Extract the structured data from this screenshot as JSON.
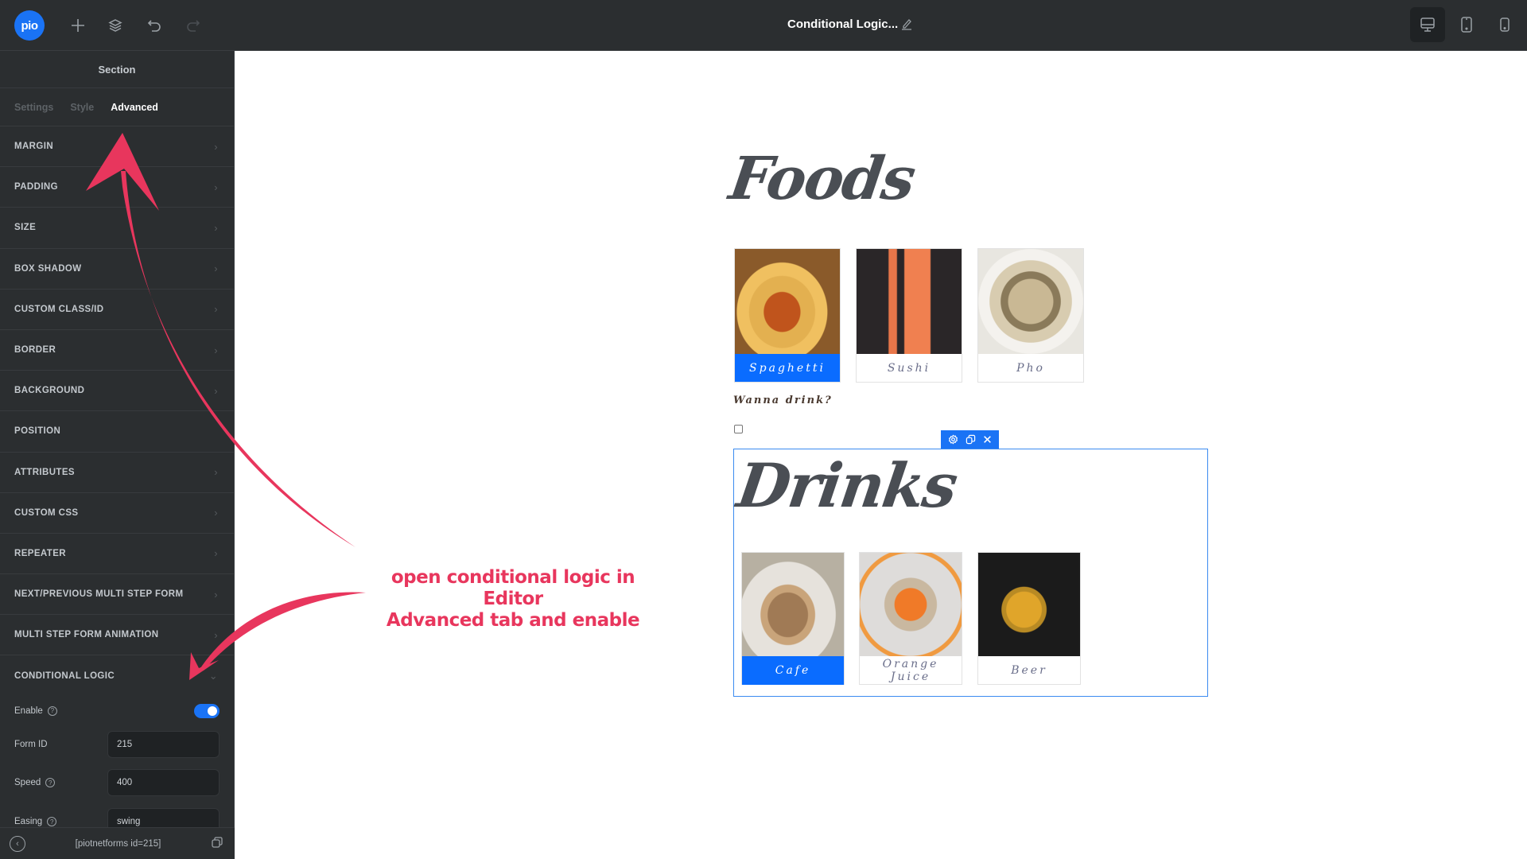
{
  "topbar": {
    "logo_text": "pio",
    "doc_title": "Conditional Logic...",
    "icons": [
      "plus-icon",
      "layers-icon",
      "undo-icon",
      "redo-icon",
      "edit-pencil-icon"
    ],
    "devices": [
      {
        "name": "desktop",
        "active": true
      },
      {
        "name": "tablet",
        "active": false
      },
      {
        "name": "mobile",
        "active": false
      }
    ]
  },
  "sidebar": {
    "title": "Section",
    "tabs": [
      {
        "label": "Settings",
        "active": false
      },
      {
        "label": "Style",
        "active": false
      },
      {
        "label": "Advanced",
        "active": true
      }
    ],
    "rows": [
      {
        "label": "MARGIN",
        "chevron": true
      },
      {
        "label": "PADDING",
        "chevron": true
      },
      {
        "label": "SIZE",
        "chevron": true
      },
      {
        "label": "BOX SHADOW",
        "chevron": true
      },
      {
        "label": "CUSTOM CLASS/ID",
        "chevron": true
      },
      {
        "label": "BORDER",
        "chevron": true
      },
      {
        "label": "BACKGROUND",
        "chevron": true
      },
      {
        "label": "POSITION",
        "chevron": false
      },
      {
        "label": "ATTRIBUTES",
        "chevron": true
      },
      {
        "label": "CUSTOM CSS",
        "chevron": true
      },
      {
        "label": "REPEATER",
        "chevron": true
      },
      {
        "label": "NEXT/PREVIOUS MULTI STEP FORM",
        "chevron": true
      },
      {
        "label": "MULTI STEP FORM ANIMATION",
        "chevron": true
      }
    ],
    "conditional_logic": {
      "label": "CONDITIONAL LOGIC",
      "enable_label": "Enable",
      "enabled": true,
      "form_id_label": "Form ID",
      "form_id_value": "215",
      "speed_label": "Speed",
      "speed_value": "400",
      "easing_label": "Easing",
      "easing_value": "swing"
    },
    "footer": {
      "shortcode": "[piotnetforms id=215]"
    }
  },
  "canvas": {
    "foods_heading": "Foods",
    "foods": [
      {
        "label": "Spaghetti",
        "selected": true
      },
      {
        "label": "Sushi",
        "selected": false
      },
      {
        "label": "Pho",
        "selected": false
      }
    ],
    "question": "Wanna drink?",
    "checkbox_checked": false,
    "drinks_heading": "Drinks",
    "drinks": [
      {
        "label": "Cafe",
        "selected": true
      },
      {
        "label": "Orange Juice",
        "selected": false
      },
      {
        "label": "Beer",
        "selected": false
      }
    ],
    "element_toolbar": [
      "settings-icon",
      "duplicate-icon",
      "close-icon"
    ]
  },
  "annotation": {
    "line1": "open conditional logic in Editor",
    "line2": "Advanced tab and enable",
    "color": "#e8365d"
  },
  "colors": {
    "accent": "#1a73f5",
    "selected_card": "#0a6cff",
    "panel_bg": "#2b2e30"
  }
}
